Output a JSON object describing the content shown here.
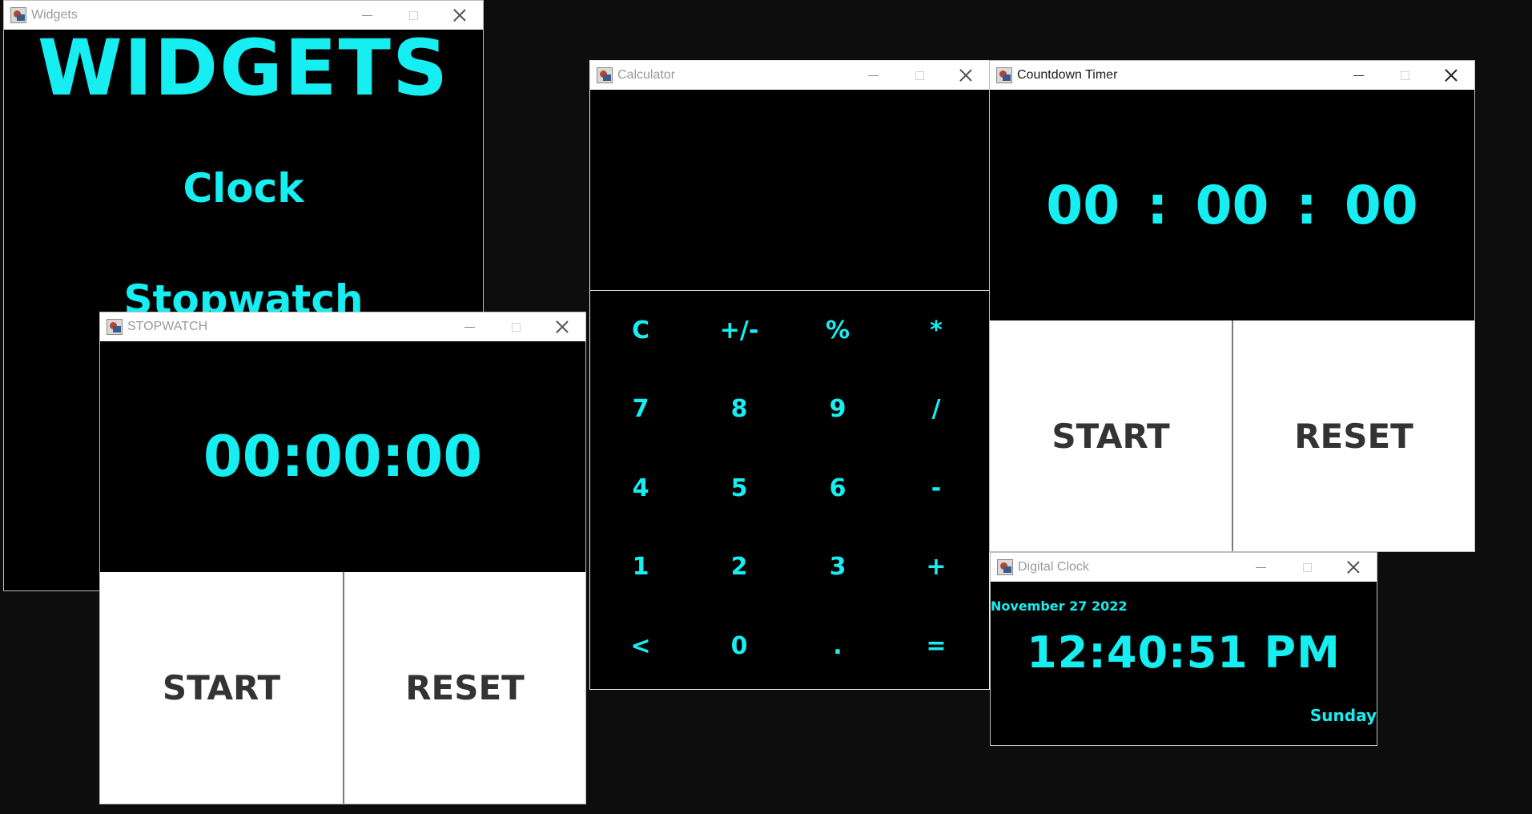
{
  "colors": {
    "accent": "#16eef2",
    "button_text": "#333333",
    "background": "#000000",
    "button_bg": "#ffffff"
  },
  "widgets_window": {
    "title": "Widgets",
    "heading": "WIDGETS",
    "items": [
      "Clock",
      "Stopwatch"
    ]
  },
  "calculator_window": {
    "title": "Calculator",
    "display": "",
    "keys": [
      "C",
      "+/-",
      "%",
      "*",
      "7",
      "8",
      "9",
      "/",
      "4",
      "5",
      "6",
      "-",
      "1",
      "2",
      "3",
      "+",
      "<",
      "0",
      ".",
      "="
    ]
  },
  "countdown_window": {
    "title": "Countdown Timer",
    "hours": "00",
    "minutes": "00",
    "seconds": "00",
    "separator": ":",
    "start_label": "START",
    "reset_label": "RESET"
  },
  "stopwatch_window": {
    "title": "STOPWATCH",
    "time": "00:00:00",
    "start_label": "START",
    "reset_label": "RESET"
  },
  "digital_clock_window": {
    "title": "Digital Clock",
    "date": "November 27 2022",
    "time": "12:40:51 PM",
    "day": "Sunday"
  }
}
